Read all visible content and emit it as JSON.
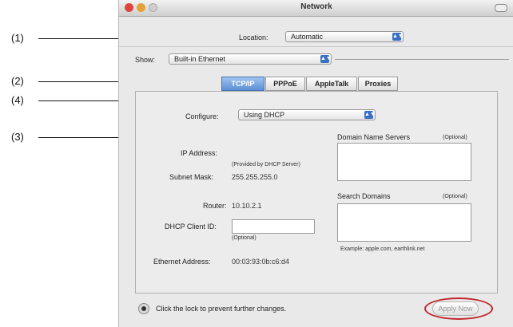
{
  "callouts": [
    "(1)",
    "(2)",
    "(4)",
    "(3)"
  ],
  "window": {
    "title": "Network",
    "traffic_lights": {
      "close": "#e0443e",
      "minimize": "#e2a23a",
      "zoom": "#cfcfcf"
    }
  },
  "location": {
    "label": "Location:",
    "value": "Automatic"
  },
  "show": {
    "label": "Show:",
    "value": "Built-in Ethernet"
  },
  "tabs": [
    {
      "label": "TCP/IP",
      "active": true
    },
    {
      "label": "PPPoE",
      "active": false
    },
    {
      "label": "AppleTalk",
      "active": false
    },
    {
      "label": "Proxies",
      "active": false
    }
  ],
  "configure": {
    "label": "Configure:",
    "value": "Using DHCP"
  },
  "ip": {
    "label": "IP Address:",
    "note": "(Provided by DHCP Server)"
  },
  "subnet": {
    "label": "Subnet Mask:",
    "value": "255.255.255.0"
  },
  "router": {
    "label": "Router:",
    "value": "10.10.2.1"
  },
  "dhcp_client": {
    "label": "DHCP Client ID:",
    "value": "",
    "note": "(Optional)"
  },
  "ethernet": {
    "label": "Ethernet Address:",
    "value": "00:03:93:0b:c6:d4"
  },
  "dns": {
    "label": "Domain Name Servers",
    "note": "(Optional)"
  },
  "search_domains": {
    "label": "Search Domains",
    "note": "(Optional)",
    "example": "Example: apple.com, earthlink.net"
  },
  "lock_text": "Click the lock to prevent further changes.",
  "apply_label": "Apply Now",
  "highlight_color": "#c0262b"
}
